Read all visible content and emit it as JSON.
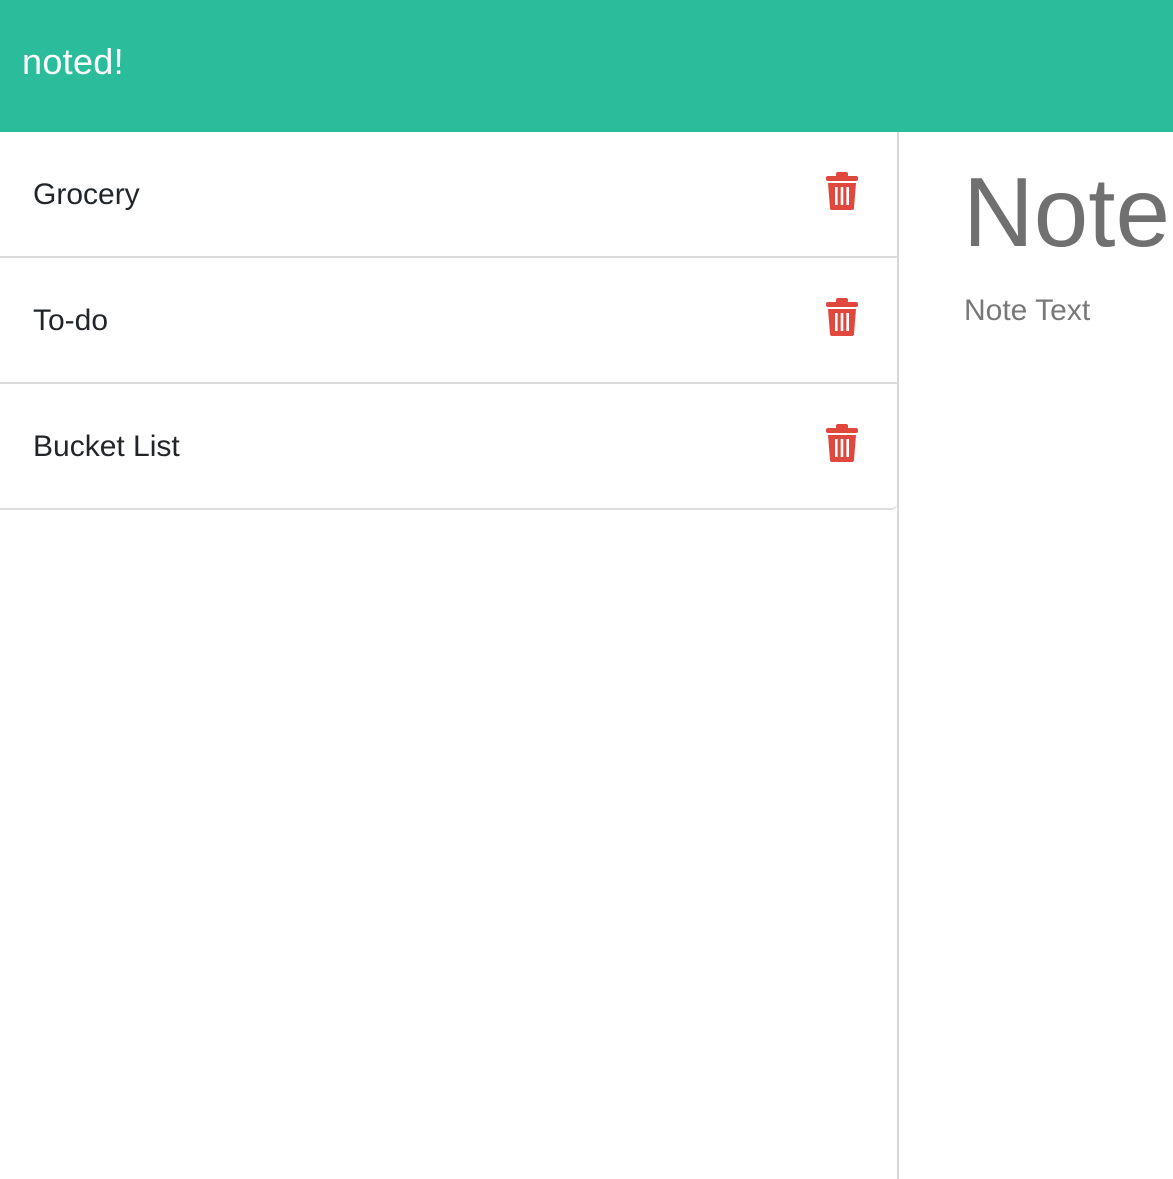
{
  "app": {
    "brand": "noted!",
    "accent_color": "#2bbd9b",
    "delete_color": "#e0483e"
  },
  "notes": {
    "items": [
      {
        "title": "Grocery",
        "delete_icon": "trash-icon"
      },
      {
        "title": "To-do",
        "delete_icon": "trash-icon"
      },
      {
        "title": "Bucket List",
        "delete_icon": "trash-icon"
      }
    ]
  },
  "editor": {
    "title_placeholder": "Note Title",
    "title_value": "",
    "text_placeholder": "Note Text",
    "text_value": ""
  }
}
